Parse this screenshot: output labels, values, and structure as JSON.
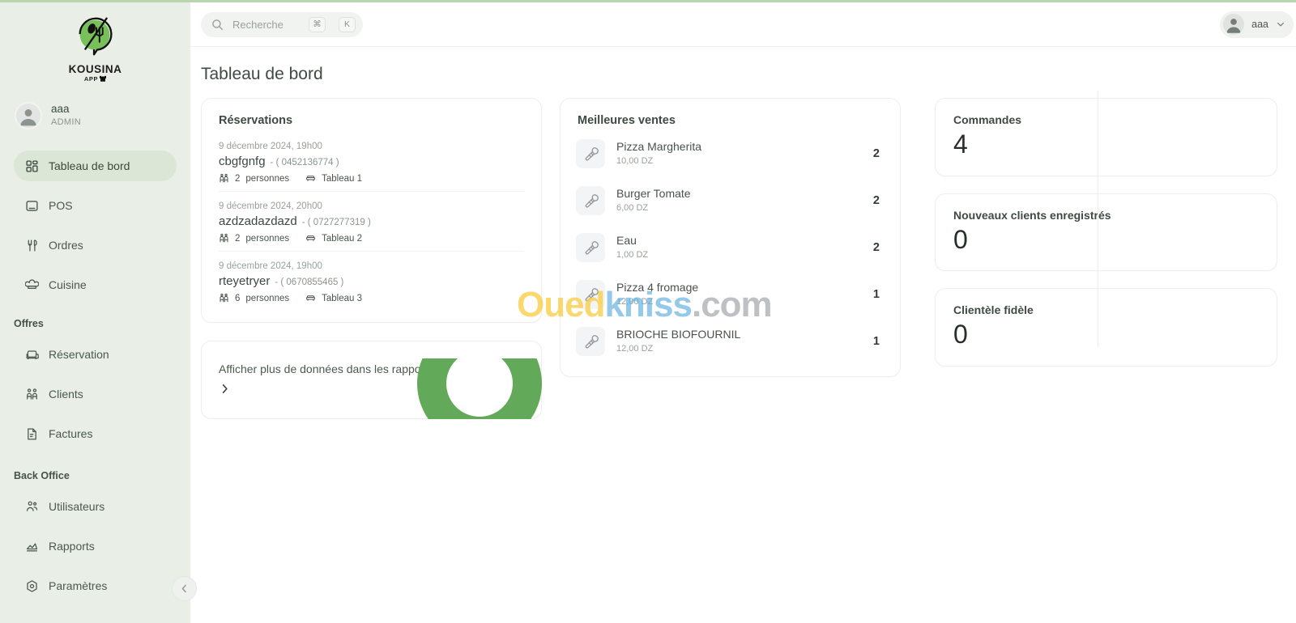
{
  "brand": {
    "name": "KOUSINA",
    "sub": "APP",
    "logo_icon": "kousina-chat-fork-logo",
    "accent_green": "#72b95f",
    "sidebar_bg": "#e9efe7"
  },
  "sidebar": {
    "user": {
      "name": "aaa",
      "role": "ADMIN",
      "avatar_icon": "user-avatar-icon"
    },
    "items": [
      {
        "label": "Tableau de bord",
        "icon": "dashboard-grid-icon",
        "active": true
      },
      {
        "label": "POS",
        "icon": "pos-screen-icon",
        "active": false
      },
      {
        "label": "Ordres",
        "icon": "fork-knife-icon",
        "active": false
      },
      {
        "label": "Cuisine",
        "icon": "chef-hat-icon",
        "active": false
      }
    ],
    "group_offres": "Offres",
    "offres_items": [
      {
        "label": "Réservation",
        "icon": "armchair-icon"
      },
      {
        "label": "Clients",
        "icon": "two-people-icon"
      },
      {
        "label": "Factures",
        "icon": "invoice-file-icon"
      }
    ],
    "group_back_office": "Back Office",
    "back_office_items": [
      {
        "label": "Utilisateurs",
        "icon": "users-group-icon"
      },
      {
        "label": "Rapports",
        "icon": "chart-area-icon"
      },
      {
        "label": "Paramètres",
        "icon": "settings-hexagon-icon"
      }
    ],
    "collapse_icon": "chevron-left-icon"
  },
  "topbar": {
    "search": {
      "placeholder": "Recherche",
      "icon": "search-icon",
      "kbd1": "⌘",
      "kbd2": "K"
    },
    "user_menu": {
      "name": "aaa",
      "avatar_icon": "user-avatar-icon",
      "chevron_icon": "chevron-down-icon"
    }
  },
  "page": {
    "title": "Tableau de bord"
  },
  "reservations": {
    "title": "Réservations",
    "people_icon": "people-icon",
    "table_icon": "table-icon",
    "items": [
      {
        "date": "9 décembre 2024, 19h00",
        "name": "cbgfgnfg",
        "phone": "- ( 0452136774 )",
        "people": "2",
        "people_label": "personnes",
        "table": "Tableau 1"
      },
      {
        "date": "9 décembre 2024, 20h00",
        "name": "azdzadazdazd",
        "phone": "- ( 0727277319 )",
        "people": "2",
        "people_label": "personnes",
        "table": "Tableau 2"
      },
      {
        "date": "9 décembre 2024, 19h00",
        "name": "rteyetryer",
        "phone": "- ( 0670855465 )",
        "people": "6",
        "people_label": "personnes",
        "table": "Tableau 3"
      }
    ]
  },
  "best_sellers": {
    "title": "Meilleures ventes",
    "item_icon": "carrot-icon",
    "items": [
      {
        "name": "Pizza Margherita",
        "price": "10,00 DZ",
        "qty": "2"
      },
      {
        "name": "Burger Tomate",
        "price": "6,00 DZ",
        "qty": "2"
      },
      {
        "name": "Eau",
        "price": "1,00 DZ",
        "qty": "2"
      },
      {
        "name": "Pizza 4 fromage",
        "price": "12,00 DZ",
        "qty": "1"
      },
      {
        "name": "BRIOCHE BIOFOURNIL",
        "price": "12,00 DZ",
        "qty": "1"
      }
    ]
  },
  "stats": [
    {
      "label": "Commandes",
      "value": "4"
    },
    {
      "label": "Nouveaux clients enregistrés",
      "value": "0"
    },
    {
      "label": "Clientèle fidèle",
      "value": "0"
    }
  ],
  "reports_link": {
    "label": "Afficher plus de données dans les rapports",
    "chevron_icon": "chevron-right-icon"
  },
  "watermark": {
    "part1": "Oued",
    "part2": "kniss",
    "part3": ".com",
    "ring_color": "#62a95a"
  }
}
